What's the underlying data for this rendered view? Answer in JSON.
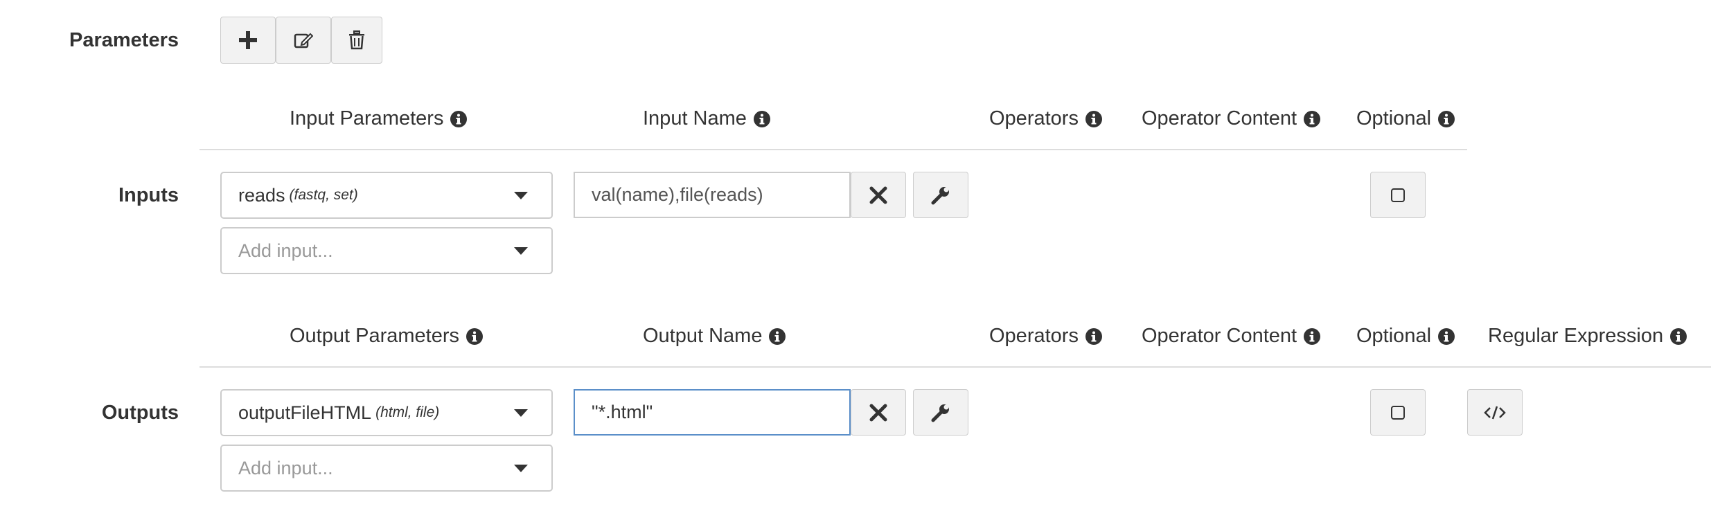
{
  "parameters": {
    "label": "Parameters",
    "toolbar": {
      "add_icon": "plus-icon",
      "edit_icon": "edit-icon",
      "delete_icon": "trash-icon"
    }
  },
  "inputs": {
    "label": "Inputs",
    "headers": {
      "params": "Input Parameters",
      "name": "Input Name",
      "operators": "Operators",
      "operator_content": "Operator Content",
      "optional": "Optional"
    },
    "rows": [
      {
        "param": "reads",
        "param_hint": "(fastq, set)",
        "name_value": "val(name),file(reads)",
        "optional": false
      }
    ],
    "add_placeholder": "Add input..."
  },
  "outputs": {
    "label": "Outputs",
    "headers": {
      "params": "Output Parameters",
      "name": "Output Name",
      "operators": "Operators",
      "operator_content": "Operator Content",
      "optional": "Optional",
      "regex": "Regular Expression"
    },
    "rows": [
      {
        "param": "outputFileHTML",
        "param_hint": "(html, file)",
        "name_value": "\"*.html\"",
        "optional": false
      }
    ],
    "add_placeholder": "Add input..."
  },
  "colors": {
    "focus_border": "#5b8fc9",
    "button_bg": "#f2f2f2",
    "border": "#cccccc"
  }
}
